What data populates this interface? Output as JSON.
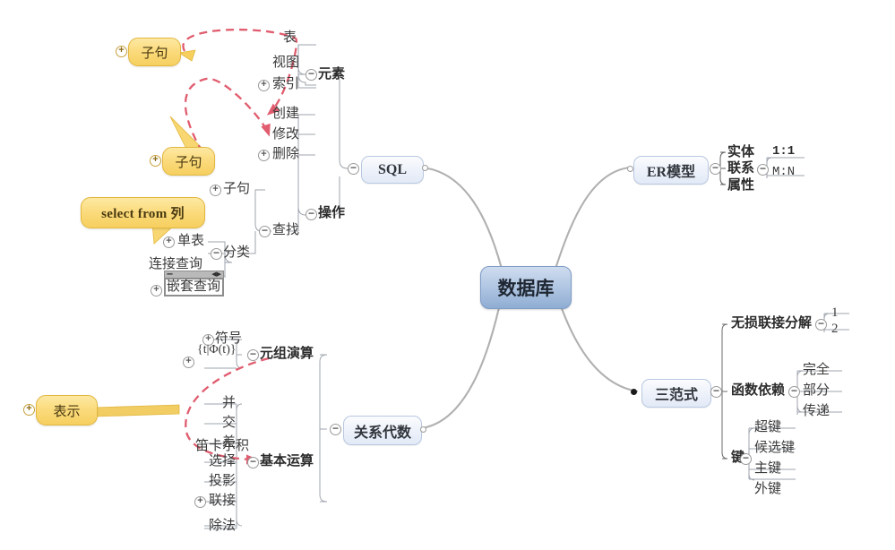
{
  "mindmap": {
    "root": {
      "label": "数据库"
    },
    "branches": {
      "sql": {
        "label": "SQL",
        "groups": [
          {
            "label": "元素",
            "children": [
              "表",
              "视图",
              "索引"
            ]
          },
          {
            "label": "操作",
            "children": [
              "创建",
              "修改",
              "删除",
              "查找"
            ]
          }
        ],
        "find": {
          "label": "查找",
          "children": [
            "子句",
            "分类"
          ]
        },
        "classify": {
          "label": "分类",
          "children": [
            "单表",
            "连接查询",
            "嵌套查询"
          ]
        }
      },
      "er": {
        "label": "ER模型",
        "children": [
          "实体",
          "联系",
          "属性"
        ],
        "relation": {
          "label": "联系",
          "children": [
            "1:1",
            "M:N"
          ]
        }
      },
      "algebra": {
        "label": "关系代数",
        "groups": [
          {
            "label": "元组演算",
            "children": [
              "符号",
              "{t|Φ(t)}"
            ]
          },
          {
            "label": "基本运算",
            "children": [
              "并",
              "交",
              "差",
              "笛卡尔积",
              "选择",
              "投影",
              "联接",
              "除法"
            ]
          }
        ]
      },
      "normalform": {
        "label": "三范式",
        "groups": [
          {
            "label": "无损联接分解",
            "children": [
              "1",
              "2"
            ]
          },
          {
            "label": "函数依赖",
            "children": [
              "完全",
              "部分",
              "传递"
            ]
          },
          {
            "label": "键",
            "children": [
              "超键",
              "候选键",
              "主键",
              "外键"
            ]
          }
        ]
      }
    },
    "callouts": [
      {
        "id": "clause_top",
        "label": "子句"
      },
      {
        "id": "clause_mid",
        "label": "子句"
      },
      {
        "id": "select_from",
        "label": "select from 列"
      },
      {
        "id": "express",
        "label": "表示"
      }
    ],
    "toggles": {
      "collapsed": "+",
      "expanded": "−"
    }
  }
}
